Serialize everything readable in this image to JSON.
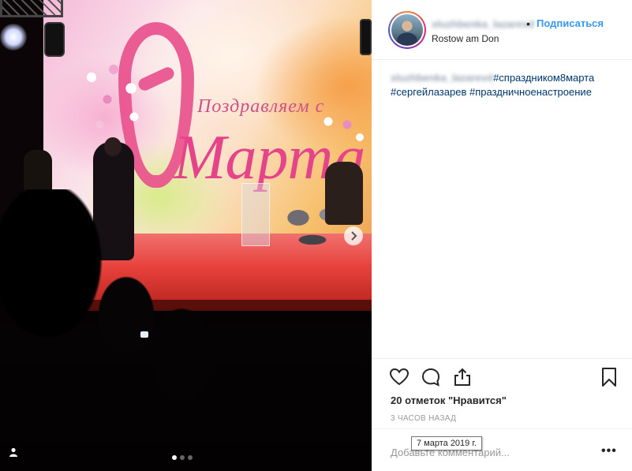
{
  "photo": {
    "backdrop_congrats": "Поздравляем с",
    "backdrop_march": "Марта",
    "carousel_dots_total": 3,
    "carousel_active_index": 0,
    "next_icon": "chevron-right-icon",
    "tag_icon": "user-tag-icon"
  },
  "header": {
    "username": "sluzhbenka_lazarevd",
    "separator": "•",
    "follow_label": "Подписаться",
    "location": "Rostow am Don"
  },
  "caption": {
    "username": "sluzhbenka_lazarevd",
    "hashtags": [
      "#спраздником8марта",
      "#сергейлазарев",
      "#праздничноенастроение"
    ]
  },
  "actions": {
    "like_icon": "heart-icon",
    "comment_icon": "comment-icon",
    "share_icon": "share-icon",
    "save_icon": "bookmark-icon"
  },
  "likes_text": "20 отметок \"Нравится\"",
  "time_text": "3 часов назад",
  "tooltip_text": "7 марта 2019 г.",
  "comment": {
    "placeholder": "Добавьте комментарий...",
    "more_label": "•••"
  },
  "colors": {
    "accent": "#3897f0",
    "hashtag": "#003569",
    "stage_red": "#e8413c",
    "backdrop_pink": "#e94f8c"
  }
}
